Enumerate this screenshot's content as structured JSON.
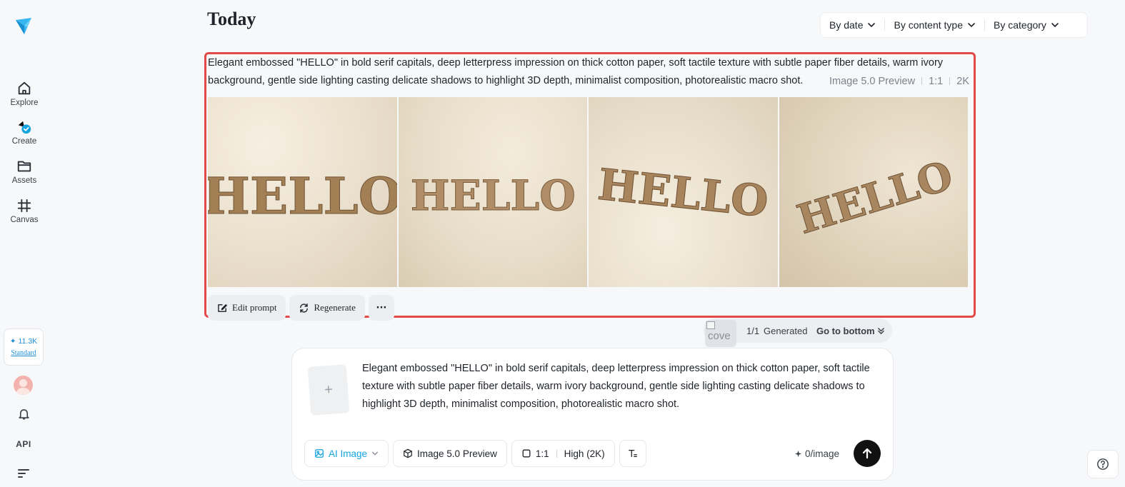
{
  "sidebar": {
    "items": [
      {
        "label": "Explore",
        "icon": "home-icon"
      },
      {
        "label": "Create",
        "icon": "create-icon"
      },
      {
        "label": "Assets",
        "icon": "folder-icon"
      },
      {
        "label": "Canvas",
        "icon": "canvas-icon"
      }
    ],
    "credits": "✦ 11.3K",
    "plan": "Standard",
    "api_label": "API"
  },
  "header": {
    "title": "Today",
    "filters": [
      "By date",
      "By content type",
      "By category"
    ]
  },
  "generation": {
    "prompt": "Elegant embossed \"HELLO\" in bold serif capitals, deep letterpress impression on thick cotton paper, soft tactile texture with subtle paper fiber details, warm ivory background, gentle side lighting casting delicate shadows to highlight 3D depth, minimalist composition, photorealistic macro shot.",
    "model": "Image 5.0 Preview",
    "ratio": "1:1",
    "resolution": "2K",
    "images": [
      {
        "text": "HELLO"
      },
      {
        "text": "HELLO"
      },
      {
        "text": "HELLO"
      },
      {
        "text": "HELLO"
      }
    ],
    "actions": {
      "edit": "Edit prompt",
      "regenerate": "Regenerate",
      "more": "···"
    }
  },
  "status": {
    "thumb_alt": "cove",
    "count": "1/1",
    "label": "Generated",
    "go_bottom": "Go to bottom"
  },
  "composer": {
    "upload": "+",
    "prompt": "Elegant embossed \"HELLO\" in bold serif capitals, deep letterpress impression on thick cotton paper, soft tactile texture with subtle paper fiber details, warm ivory background, gentle side lighting casting delicate shadows to highlight 3D depth, minimalist composition, photorealistic macro shot.",
    "mode": "AI Image",
    "model": "Image 5.0 Preview",
    "ratio": "1:1",
    "quality": "High (2K)",
    "cost": "0/image"
  },
  "colors": {
    "accent": "#16a4e0",
    "highlight": "#e24a4a",
    "send": "#111111"
  }
}
